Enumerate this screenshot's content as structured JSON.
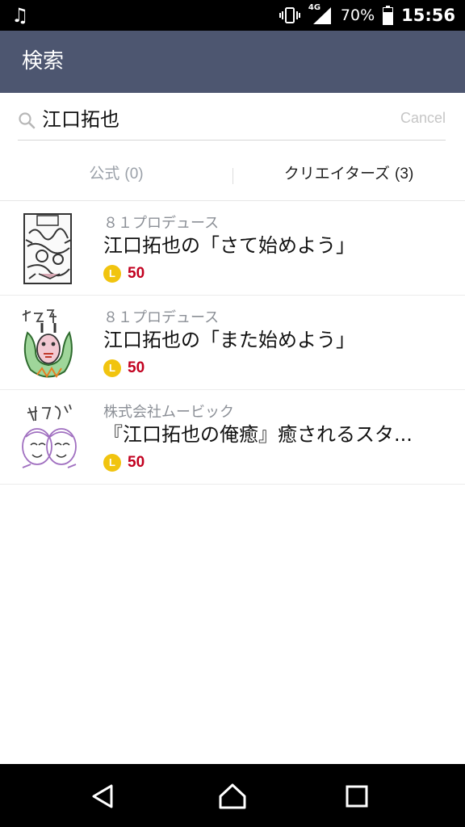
{
  "status": {
    "battery": "70%",
    "time": "15:56",
    "network": "4G"
  },
  "header": {
    "title": "検索"
  },
  "search": {
    "query": "江口拓也",
    "cancel": "Cancel"
  },
  "tabs": [
    {
      "label": "公式",
      "count": "(0)",
      "selected": false
    },
    {
      "label": "クリエイターズ",
      "count": "(3)",
      "selected": true
    }
  ],
  "results": [
    {
      "maker": "８１プロデュース",
      "name": "江口拓也の「さて始めよう」",
      "price": "50"
    },
    {
      "maker": "８１プロデュース",
      "name": "江口拓也の「また始めよう」",
      "price": "50"
    },
    {
      "maker": "株式会社ムービック",
      "name": "『江口拓也の俺癒』癒されるスタ...",
      "price": "50"
    }
  ],
  "coin_letter": "L",
  "colors": {
    "header_bg": "#4d5670",
    "price": "#c2001f",
    "coin": "#f1c40f"
  }
}
